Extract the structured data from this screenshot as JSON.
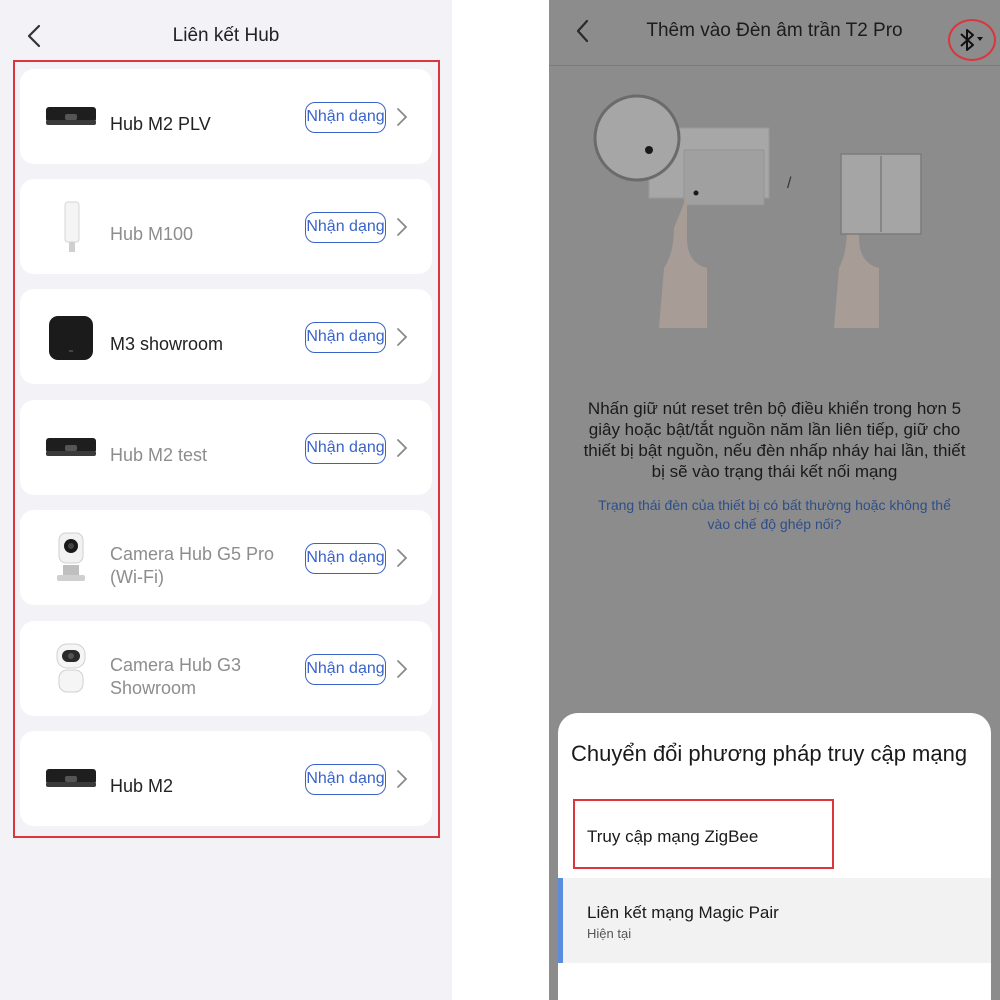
{
  "left_screen": {
    "title": "Liên kết Hub",
    "identify_label": "Nhận dạng",
    "hubs": [
      {
        "name": "Hub M2 PLV",
        "online": true,
        "thumb": "hub-m2-device-icon"
      },
      {
        "name": "Hub M100",
        "online": false,
        "thumb": "hub-m100-device-icon"
      },
      {
        "name": "M3 showroom",
        "online": true,
        "thumb": "hub-m3-device-icon"
      },
      {
        "name": "Hub M2 test",
        "online": false,
        "thumb": "hub-m2-device-icon"
      },
      {
        "name": "Camera Hub G5 Pro (Wi-Fi)",
        "online": false,
        "thumb": "camera-g5-device-icon"
      },
      {
        "name": "Camera Hub G3 Showroom",
        "online": false,
        "thumb": "camera-g3-device-icon"
      },
      {
        "name": "Hub M2",
        "online": true,
        "thumb": "hub-m2-device-icon"
      }
    ]
  },
  "right_screen": {
    "title": "Thêm vào Đèn âm trần T2 Pro",
    "illustration_separator": "/",
    "instruction": "Nhấn giữ nút reset trên bộ điều khiển trong hơn 5 giây hoặc bật/tắt nguồn năm lần liên tiếp, giữ cho thiết bị bật nguồn, nếu đèn nhấp nháy hai lần, thiết bị sẽ vào trạng thái kết nối mạng",
    "help_link": "Trạng thái đèn của thiết bị có bất thường hoặc không thể vào chế độ ghép nối?",
    "sheet": {
      "title": "Chuyển đổi phương pháp truy cập mạng",
      "options": [
        {
          "label": "Truy cập mạng ZigBee",
          "sub": ""
        },
        {
          "label": "Liên kết mạng Magic Pair",
          "sub": "Hiện tại"
        }
      ]
    }
  },
  "colors": {
    "accent_blue": "#3a63c9",
    "highlight_red": "#d9363e",
    "selected_bar": "#5a8de0",
    "left_bg": "#f2f2f7",
    "right_overlay": "#8c8c8c"
  }
}
